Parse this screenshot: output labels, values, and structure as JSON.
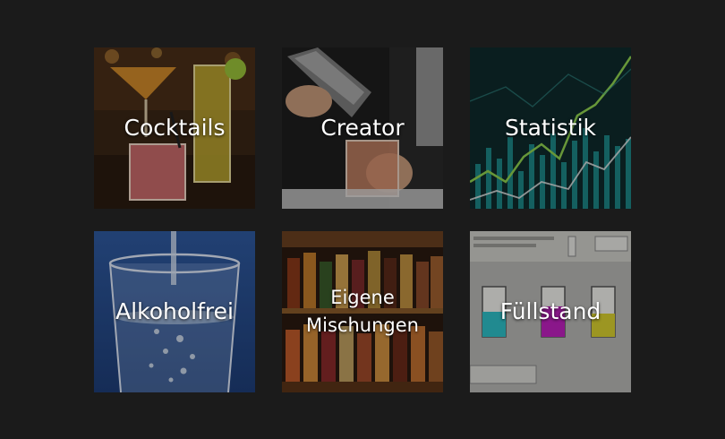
{
  "menu": {
    "tiles": [
      {
        "label": "Cocktails",
        "image": "cocktail-glasses-icon"
      },
      {
        "label": "Creator",
        "image": "cocktail-shaker-icon"
      },
      {
        "label": "Statistik",
        "image": "line-chart-icon"
      },
      {
        "label": "Alkoholfrei",
        "image": "water-glass-icon"
      },
      {
        "label": "Eigene\nMischungen",
        "image": "bottle-shelf-icon"
      },
      {
        "label": "Füllstand",
        "image": "ink-level-icon"
      }
    ]
  },
  "chart_thumbnail": {
    "line_color": "#8fd14f",
    "bar_color": "#1f8f8f"
  }
}
